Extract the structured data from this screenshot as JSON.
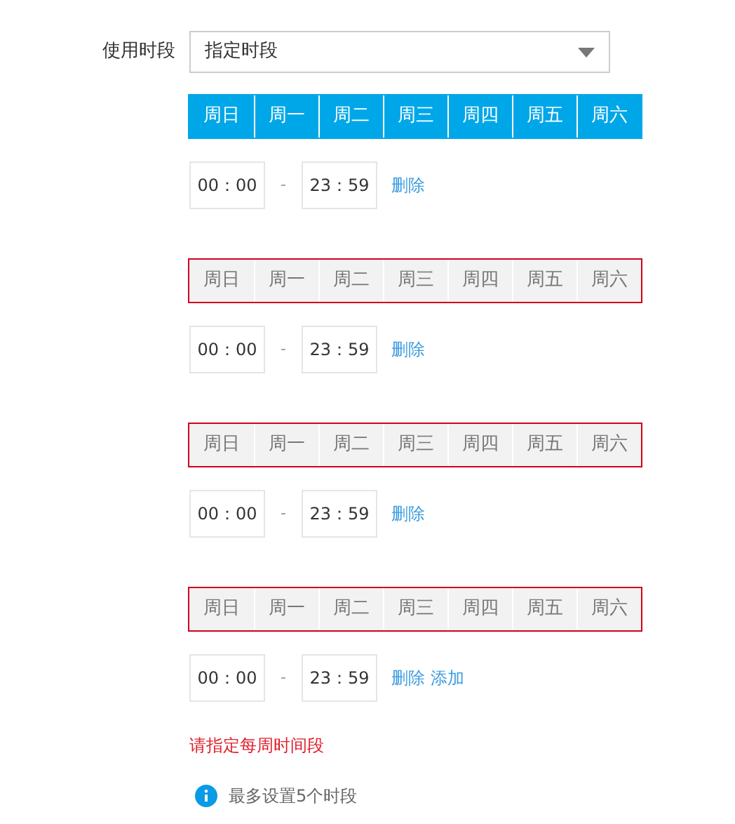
{
  "field_label": "使用时段",
  "select": {
    "value": "指定时段"
  },
  "groups": [
    {
      "invalid": false,
      "days": [
        {
          "label": "周日",
          "selected": true
        },
        {
          "label": "周一",
          "selected": true
        },
        {
          "label": "周二",
          "selected": true
        },
        {
          "label": "周三",
          "selected": true
        },
        {
          "label": "周四",
          "selected": true
        },
        {
          "label": "周五",
          "selected": true
        },
        {
          "label": "周六",
          "selected": true
        }
      ],
      "start": "00：00",
      "separator": "-",
      "end": "23：59",
      "actions": [
        "删除"
      ]
    },
    {
      "invalid": true,
      "days": [
        {
          "label": "周日",
          "selected": false
        },
        {
          "label": "周一",
          "selected": false
        },
        {
          "label": "周二",
          "selected": false
        },
        {
          "label": "周三",
          "selected": false
        },
        {
          "label": "周四",
          "selected": false
        },
        {
          "label": "周五",
          "selected": false
        },
        {
          "label": "周六",
          "selected": false
        }
      ],
      "start": "00：00",
      "separator": "-",
      "end": "23：59",
      "actions": [
        "删除"
      ]
    },
    {
      "invalid": true,
      "days": [
        {
          "label": "周日",
          "selected": false
        },
        {
          "label": "周一",
          "selected": false
        },
        {
          "label": "周二",
          "selected": false
        },
        {
          "label": "周三",
          "selected": false
        },
        {
          "label": "周四",
          "selected": false
        },
        {
          "label": "周五",
          "selected": false
        },
        {
          "label": "周六",
          "selected": false
        }
      ],
      "start": "00：00",
      "separator": "-",
      "end": "23：59",
      "actions": [
        "删除"
      ]
    },
    {
      "invalid": true,
      "days": [
        {
          "label": "周日",
          "selected": false
        },
        {
          "label": "周一",
          "selected": false
        },
        {
          "label": "周二",
          "selected": false
        },
        {
          "label": "周三",
          "selected": false
        },
        {
          "label": "周四",
          "selected": false
        },
        {
          "label": "周五",
          "selected": false
        },
        {
          "label": "周六",
          "selected": false
        }
      ],
      "start": "00：00",
      "separator": "-",
      "end": "23：59",
      "actions": [
        "删除",
        "添加"
      ]
    }
  ],
  "error": "请指定每周时间段",
  "info": "最多设置5个时段"
}
